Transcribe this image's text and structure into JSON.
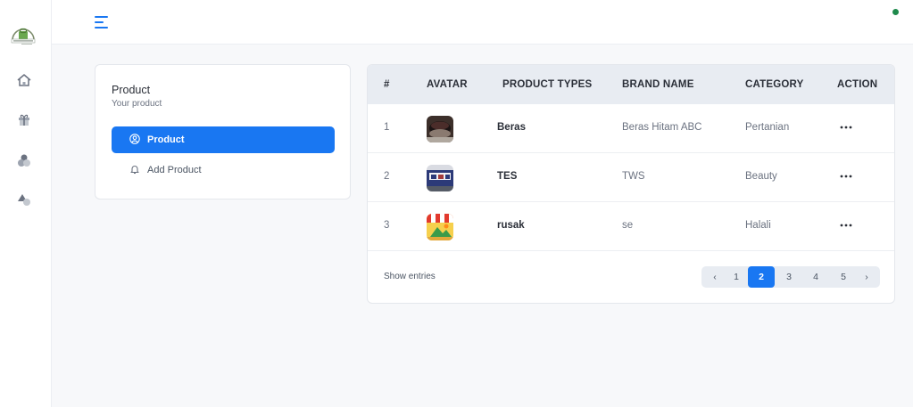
{
  "sidebar": {
    "logo_icon": "store-logo-icon",
    "items": [
      {
        "icon": "home-icon"
      },
      {
        "icon": "gift-icon"
      },
      {
        "icon": "user-group-icon"
      },
      {
        "icon": "shapes-icon"
      }
    ]
  },
  "topbar": {
    "menu_icon": "hamburger-menu-icon",
    "status_color": "#1e8a4c"
  },
  "product_menu": {
    "title": "Product",
    "subtitle": "Your product",
    "items": [
      {
        "label": "Product",
        "icon": "user-circle-icon",
        "active": true
      },
      {
        "label": "Add Product",
        "icon": "bell-icon",
        "active": false
      }
    ]
  },
  "table": {
    "headers": [
      "#",
      "AVATAR",
      "PRODUCT TYPES",
      "BRAND NAME",
      "CATEGORY",
      "ACTION"
    ],
    "rows": [
      {
        "num": "1",
        "avatar": "rice-bowl-image",
        "type": "Beras",
        "brand": "Beras Hitam ABC",
        "category": "Pertanian",
        "action": "more-icon"
      },
      {
        "num": "2",
        "avatar": "product-photo-image",
        "type": "TES",
        "brand": "TWS",
        "category": "Beauty",
        "action": "more-icon"
      },
      {
        "num": "3",
        "avatar": "store-image",
        "type": "rusak",
        "brand": "se",
        "category": "Halali",
        "action": "more-icon"
      }
    ]
  },
  "footer": {
    "show_entries": "Show  entries",
    "pagination": {
      "prev": "‹",
      "pages": [
        "1",
        "2",
        "3",
        "4",
        "5"
      ],
      "current": "2",
      "next": "›"
    }
  },
  "colors": {
    "accent": "#1977f2",
    "header_bg": "#e8ecf2"
  }
}
